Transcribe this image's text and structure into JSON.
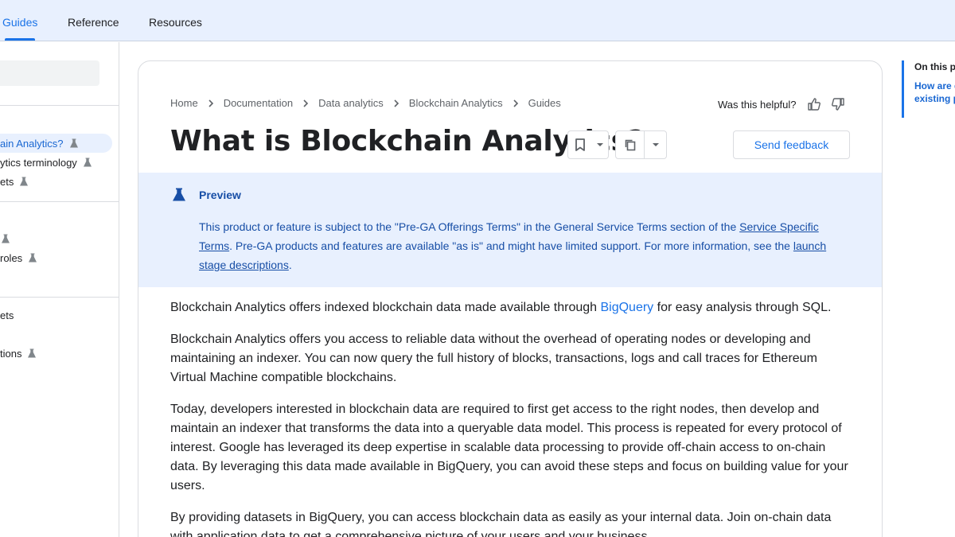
{
  "topnav": {
    "tabs": [
      "Guides",
      "Reference",
      "Resources"
    ],
    "active_tab": "Guides"
  },
  "sidebar": {
    "items": [
      {
        "label": "ain Analytics?",
        "flask": true,
        "active": true
      },
      {
        "label": "ytics terminology",
        "flask": true,
        "active": false
      },
      {
        "label": "ets",
        "flask": true,
        "active": false
      },
      {
        "label": "",
        "flask": true,
        "active": false
      },
      {
        "label": "roles",
        "flask": true,
        "active": false
      },
      {
        "label": "ets",
        "flask": false,
        "active": false
      },
      {
        "label": "tions",
        "flask": true,
        "active": false
      }
    ]
  },
  "breadcrumb": [
    "Home",
    "Documentation",
    "Data analytics",
    "Blockchain Analytics",
    "Guides"
  ],
  "helpful": {
    "label": "Was this helpful?"
  },
  "page": {
    "title": "What is Blockchain Analytics?",
    "send_feedback": "Send feedback"
  },
  "preview": {
    "title": "Preview",
    "text_1": "This product or feature is subject to the \"Pre-GA Offerings Terms\" in the General Service Terms section of the ",
    "link_1": "Service Specific Terms",
    "text_2": ". Pre-GA products and features are available \"as is\" and might have limited support. For more information, see the ",
    "link_2": "launch stage descriptions",
    "text_3": "."
  },
  "content": {
    "p1_a": "Blockchain Analytics offers indexed blockchain data made available through ",
    "p1_link": "BigQuery",
    "p1_b": " for easy analysis through SQL.",
    "p2": "Blockchain Analytics offers you access to reliable data without the overhead of operating nodes or developing and maintaining an indexer. You can now query the full history of blocks, transactions, logs and call traces for Ethereum Virtual Machine compatible blockchains.",
    "p3": "Today, developers interested in blockchain data are required to first get access to the right nodes, then develop and maintain an indexer that transforms the data into a queryable data model. This process is repeated for every protocol of interest. Google has leveraged its deep expertise in scalable data processing to provide off-chain access to on-chain data. By leveraging this data made available in BigQuery, you can avoid these steps and focus on building value for your users.",
    "p4": "By providing datasets in BigQuery, you can access blockchain data as easily as your internal data. Join on-chain data with application data to get a comprehensive picture of your users and your business."
  },
  "toc": {
    "title": "On this p",
    "link": "How are different existing p"
  },
  "colors": {
    "accent": "#1a73e8",
    "preview_bg": "#e8f0fe",
    "preview_text": "#174ea6"
  }
}
